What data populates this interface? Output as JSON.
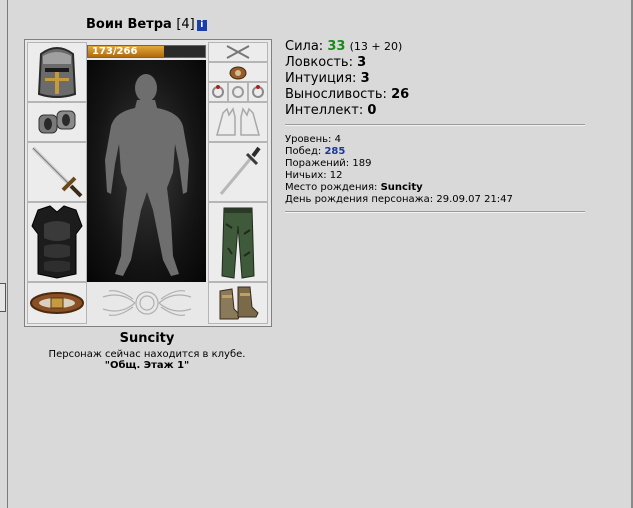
{
  "character": {
    "name": "Воин Ветра",
    "level": "[4]",
    "info_icon": "i"
  },
  "equipment": {
    "hp": {
      "text": "173/266",
      "current": 173,
      "max": 266
    },
    "slots_left": [
      "helmet-icon",
      "bracers-icon",
      "sword-icon",
      "armor-icon",
      "belt-icon"
    ],
    "slots_right": [
      "crossed-weapons-icon",
      "amulet-icon",
      "ring-icon",
      "gloves-icon",
      "dagger-icon",
      "pants-icon",
      "boots-icon"
    ],
    "emblem": "clan-emblem-icon"
  },
  "location": {
    "city": "Suncity",
    "status": "Персонаж сейчас находится в клубе.",
    "room": "\"Общ. Этаж 1\""
  },
  "stats": {
    "strength": {
      "label": "Сила:",
      "value": "33",
      "extra": "(13 + 20)"
    },
    "agility": {
      "label": "Ловкость:",
      "value": "3"
    },
    "intuition": {
      "label": "Интуиция:",
      "value": "3"
    },
    "endurance": {
      "label": "Выносливость:",
      "value": "26"
    },
    "intellect": {
      "label": "Интеллект:",
      "value": "0"
    }
  },
  "info": {
    "level": {
      "label": "Уровень:",
      "value": "4"
    },
    "wins": {
      "label": "Побед:",
      "value": "285"
    },
    "losses": {
      "label": "Поражений:",
      "value": "189"
    },
    "draws": {
      "label": "Ничьих:",
      "value": "12"
    },
    "birthplace": {
      "label": "Место рождения:",
      "value": "Suncity"
    },
    "birthday": {
      "label": "День рождения персонажа:",
      "value": "29.09.07 21:47"
    }
  },
  "colors": {
    "accent_green": "#1a8a1a",
    "accent_blue": "#1a3a9a",
    "hp_fill": "#d08a22"
  }
}
